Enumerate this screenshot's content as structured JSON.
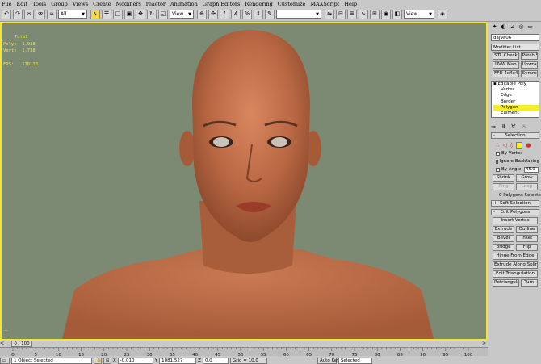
{
  "menu": [
    "File",
    "Edit",
    "Tools",
    "Group",
    "Views",
    "Create",
    "Modifiers",
    "reactor",
    "Animation",
    "Graph Editors",
    "Rendering",
    "Customize",
    "MAXScript",
    "Help"
  ],
  "toolbar": {
    "filter_value": "All",
    "refcoord_value": "View",
    "named_sel_value": "",
    "view_value": "View"
  },
  "viewport": {
    "stats_header": "Total",
    "stats_label_a": "Polys",
    "stats_value_a": "1,938",
    "stats_label_b": "Verts",
    "stats_value_b": "1,738",
    "fps_label": "FPS",
    "fps_value": "178.18"
  },
  "command_panel": {
    "object_name": "daj9a06",
    "modifier_list": "Modifier List",
    "row1": [
      "STL Check",
      "Patch Select"
    ],
    "row2": [
      "UVW Map",
      "Unwrap UVW"
    ],
    "row3": [
      "FFD 4x4x4",
      "Symmetry"
    ],
    "stack_root": "Editable Poly",
    "stack_items": [
      "Vertex",
      "Edge",
      "Border",
      "Polygon",
      "Element"
    ],
    "selected_item": "Polygon",
    "selection_title": "Selection",
    "by_vertex": "By Vertex",
    "ignore_backfacing": "Ignore Backfacing",
    "by_angle": "By Angle:",
    "by_angle_value": "45.0",
    "shrink": "Shrink",
    "grow": "Grow",
    "ring": "Ring",
    "loop": "Loop",
    "polygons_selected": "0 Polygons Selected",
    "soft_selection": "Soft Selection",
    "edit_polygons": "Edit Polygons",
    "insert_vertex": "Insert Vertex",
    "extrude": "Extrude",
    "outline": "Outline",
    "bevel": "Bevel",
    "inset": "Inset",
    "bridge": "Bridge",
    "flip": "Flip",
    "hinge_from_edge": "Hinge From Edge",
    "extrude_along_spline": "Extrude Along Spline",
    "edit_triangulation": "Edit Triangulation",
    "retriangulate": "Retriangulate",
    "turn": "Turn"
  },
  "timeline": {
    "frame_display": "0 / 100",
    "left_arrow": "<",
    "right_arrow": ">",
    "ticks": [
      0,
      5,
      10,
      15,
      20,
      25,
      30,
      35,
      40,
      45,
      50,
      55,
      60,
      65,
      70,
      75,
      80,
      85,
      90,
      95,
      100
    ]
  },
  "status": {
    "object_selected": "1 Object Selected",
    "x_label": "X",
    "x_value": "-0.010",
    "y_label": "Y",
    "y_value": "1081.527",
    "z_label": "Z",
    "z_value": "0.0",
    "grid": "Grid = 10.0",
    "auto_key": "Auto Key",
    "selected": "Selected"
  },
  "colors": {
    "viewport_bg": "#7c8a73",
    "viewport_border": "#f2e633",
    "selection_highlight": "#f5ec2b"
  }
}
